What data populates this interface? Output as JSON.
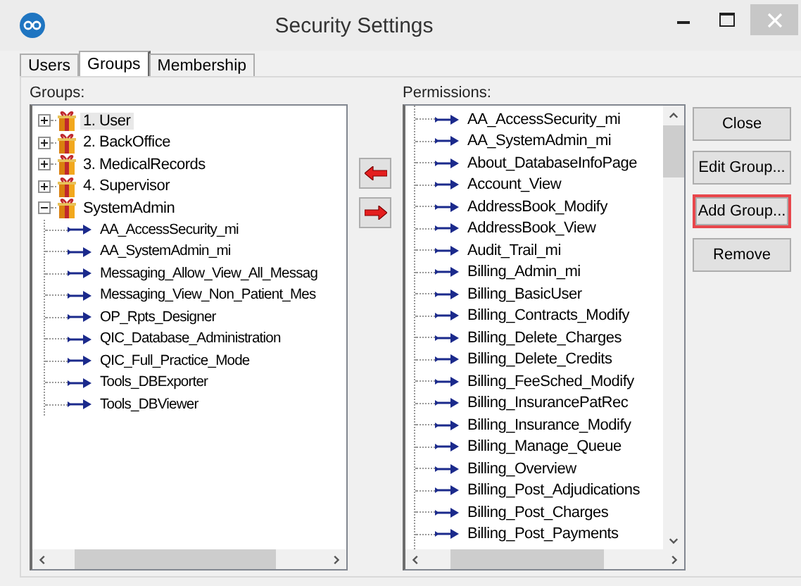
{
  "window": {
    "title": "Security Settings"
  },
  "tabs": [
    {
      "label": "Users",
      "selected": false
    },
    {
      "label": "Groups",
      "selected": true
    },
    {
      "label": "Membership",
      "selected": false
    }
  ],
  "groups": {
    "label": "Groups:",
    "items": [
      {
        "label": "1. User",
        "expanded": false,
        "selected": true
      },
      {
        "label": "2. BackOffice",
        "expanded": false,
        "selected": false
      },
      {
        "label": "3. MedicalRecords",
        "expanded": false,
        "selected": false
      },
      {
        "label": "4. Supervisor",
        "expanded": false,
        "selected": false
      },
      {
        "label": "SystemAdmin",
        "expanded": true,
        "selected": false,
        "children": [
          {
            "label": "AA_AccessSecurity_mi"
          },
          {
            "label": "AA_SystemAdmin_mi"
          },
          {
            "label": "Messaging_Allow_View_All_Messag"
          },
          {
            "label": "Messaging_View_Non_Patient_Mes"
          },
          {
            "label": "OP_Rpts_Designer"
          },
          {
            "label": "QIC_Database_Administration"
          },
          {
            "label": "QIC_Full_Practice_Mode"
          },
          {
            "label": "Tools_DBExporter"
          },
          {
            "label": "Tools_DBViewer"
          }
        ]
      }
    ]
  },
  "permissions": {
    "label": "Permissions:",
    "items": [
      "AA_AccessSecurity_mi",
      "AA_SystemAdmin_mi",
      "About_DatabaseInfoPage",
      "Account_View",
      "AddressBook_Modify",
      "AddressBook_View",
      "Audit_Trail_mi",
      "Billing_Admin_mi",
      "Billing_BasicUser",
      "Billing_Contracts_Modify",
      "Billing_Delete_Charges",
      "Billing_Delete_Credits",
      "Billing_FeeSched_Modify",
      "Billing_InsurancePatRec",
      "Billing_Insurance_Modify",
      "Billing_Manage_Queue",
      "Billing_Overview",
      "Billing_Post_Adjudications",
      "Billing_Post_Charges",
      "Billing_Post_Payments"
    ]
  },
  "buttons": [
    {
      "label": "Close",
      "highlighted": false
    },
    {
      "label": "Edit Group...",
      "highlighted": false
    },
    {
      "label": "Add Group...",
      "highlighted": true
    },
    {
      "label": "Remove",
      "highlighted": false
    }
  ]
}
